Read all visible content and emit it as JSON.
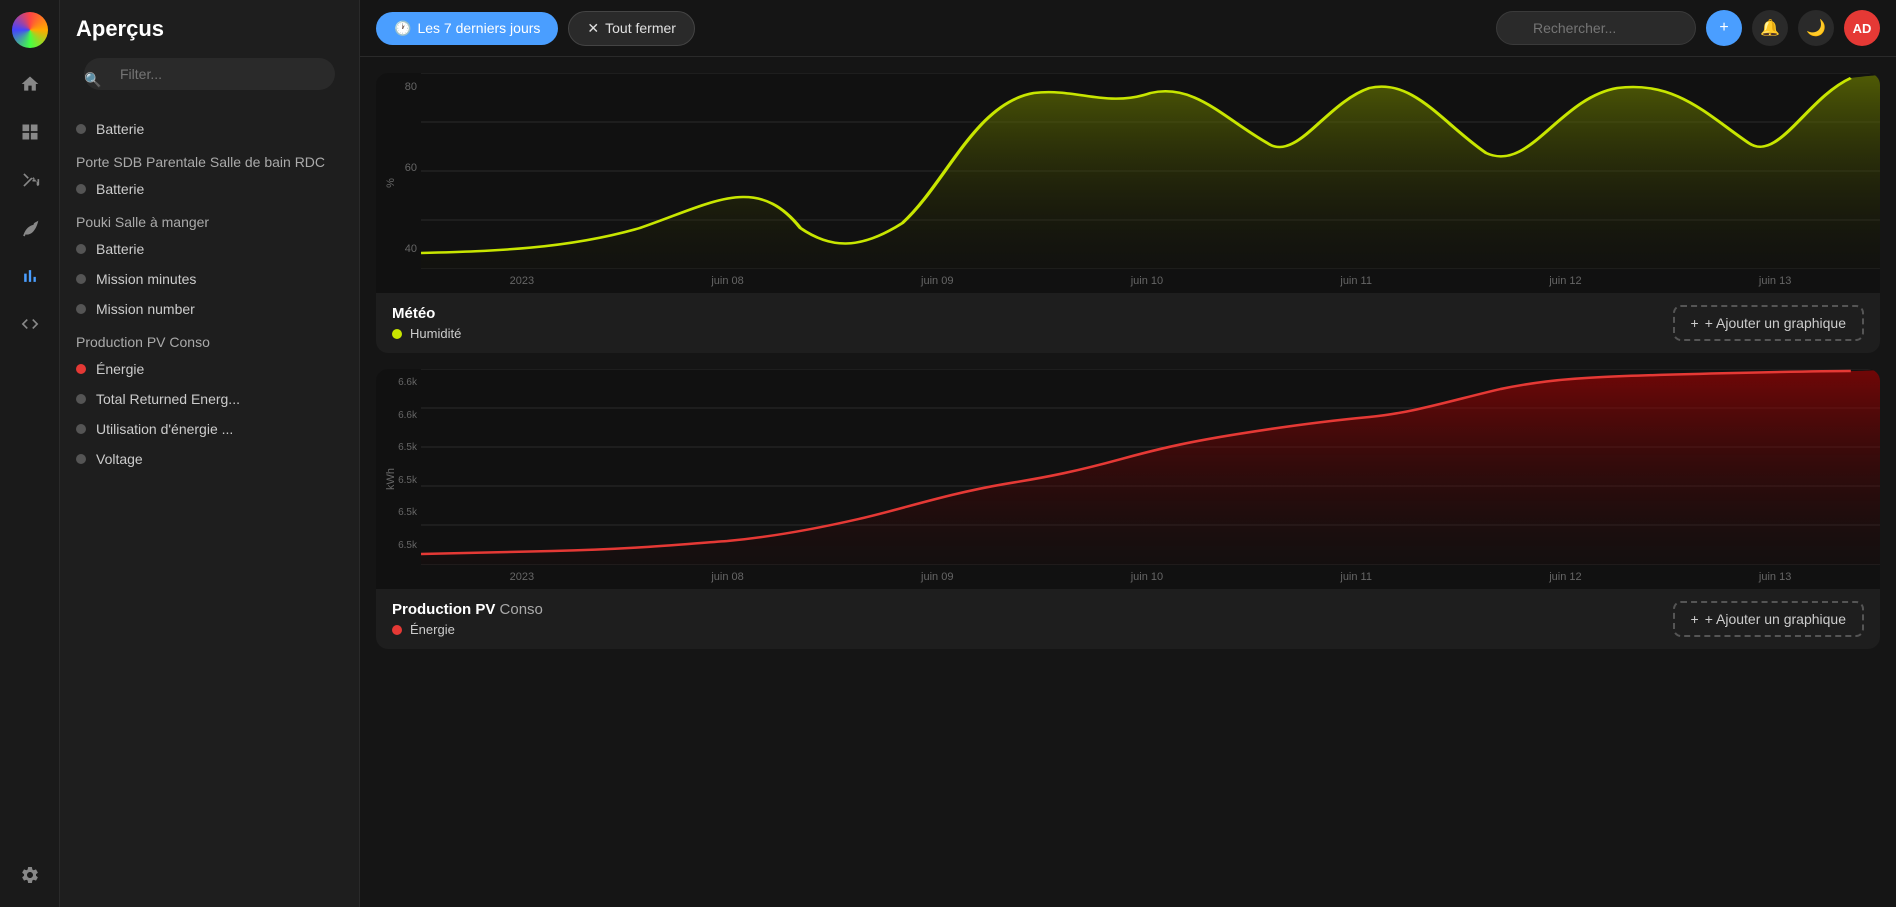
{
  "app": {
    "title": "Aperçus"
  },
  "topbar": {
    "time_filter_label": "Les 7 derniers jours",
    "close_all_label": "Tout fermer",
    "search_placeholder": "Rechercher...",
    "add_label": "+",
    "user_initials": "AD"
  },
  "sidebar": {
    "filter_placeholder": "Filter...",
    "items_top": [
      {
        "label": "Batterie",
        "dot": "gray"
      }
    ],
    "groups": [
      {
        "title": "Porte SDB Parentale",
        "subtitle": "Salle de bain RDC",
        "items": [
          {
            "label": "Batterie",
            "dot": "gray"
          }
        ]
      },
      {
        "title": "Pouki",
        "subtitle": "Salle à manger",
        "items": [
          {
            "label": "Batterie",
            "dot": "gray"
          },
          {
            "label": "Mission minutes",
            "dot": "gray"
          },
          {
            "label": "Mission number",
            "dot": "gray"
          }
        ]
      },
      {
        "title": "Production PV",
        "subtitle": "Conso",
        "items": [
          {
            "label": "Énergie",
            "dot": "red"
          },
          {
            "label": "Total Returned Energ...",
            "dot": "gray"
          },
          {
            "label": "Utilisation d'énergie ...",
            "dot": "gray"
          },
          {
            "label": "Voltage",
            "dot": "gray"
          }
        ]
      }
    ]
  },
  "nav_icons": [
    {
      "name": "home-icon",
      "symbol": "⌂",
      "active": false
    },
    {
      "name": "grid-icon",
      "symbol": "⊞",
      "active": false
    },
    {
      "name": "shuffle-icon",
      "symbol": "⇄",
      "active": false
    },
    {
      "name": "leaf-icon",
      "symbol": "🌿",
      "active": false
    },
    {
      "name": "chart-icon",
      "symbol": "▦",
      "active": true
    },
    {
      "name": "code-icon",
      "symbol": "</>",
      "active": false
    },
    {
      "name": "settings-icon",
      "symbol": "⚙",
      "active": false
    }
  ],
  "charts": [
    {
      "id": "meteo",
      "title": "Météo",
      "legend_items": [
        {
          "label": "Humidité",
          "color": "#c8e600"
        }
      ],
      "y_labels": [
        "80",
        "",
        "60",
        "",
        "40"
      ],
      "y_unit": "%",
      "x_labels": [
        "2023",
        "juin 08",
        "juin 09",
        "juin 10",
        "juin 11",
        "juin 12",
        "juin 13"
      ],
      "line_color": "#c8e600",
      "fill_color": "rgba(100,120,0,0.4)"
    },
    {
      "id": "production",
      "title": "Production PV",
      "title_suffix": "Conso",
      "legend_items": [
        {
          "label": "Énergie",
          "color": "#e53935"
        }
      ],
      "y_labels": [
        "6.6k",
        "6.6k",
        "6.5k",
        "6.5k",
        "6.5k",
        "6.5k"
      ],
      "y_unit": "kWh",
      "x_labels": [
        "2023",
        "juin 08",
        "juin 09",
        "juin 10",
        "juin 11",
        "juin 12",
        "juin 13"
      ],
      "line_color": "#e53935",
      "fill_color": "rgba(180,0,0,0.3)"
    }
  ],
  "add_chart_label": "+ Ajouter un graphique"
}
